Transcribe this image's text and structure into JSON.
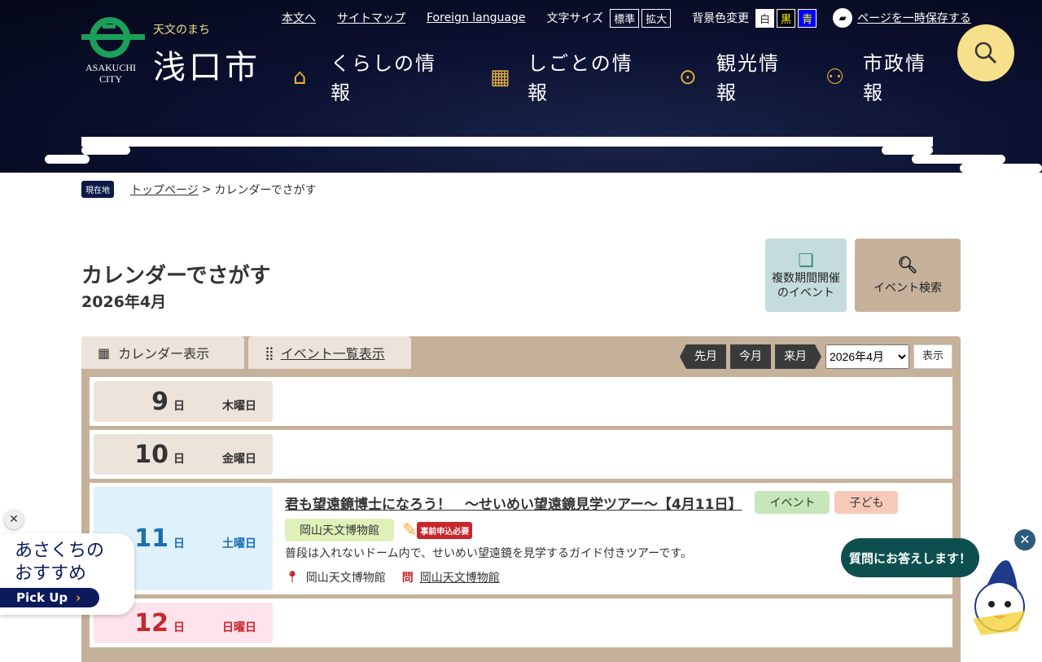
{
  "header": {
    "logo_en": "ASAKUCHI CITY",
    "logo_tagline": "天文のまち",
    "logo_city": "浅口市",
    "links": [
      "本文へ",
      "サイトマップ",
      "Foreign language"
    ],
    "font_size_label": "文字サイズ",
    "font_sizes": [
      "標準",
      "拡大"
    ],
    "bg_label": "背景色変更",
    "bg_options": [
      "白",
      "黒",
      "青"
    ],
    "save_page": "ページを一時保存する",
    "nav": [
      "くらしの情報",
      "しごとの情報",
      "観光情報",
      "市政情報"
    ]
  },
  "breadcrumb": {
    "here": "現在地",
    "home": "トップページ",
    "current": "カレンダーでさがす"
  },
  "page": {
    "title": "カレンダーでさがす",
    "month": "2026年4月",
    "multi_period": "複数期間開催のイベント",
    "event_search": "イベント検索"
  },
  "tabs": {
    "calendar": "カレンダー表示",
    "list": "イベント一覧表示"
  },
  "controls": {
    "prev": "先月",
    "current": "今月",
    "next": "来月",
    "selected_month": "2026年4月",
    "show": "表示"
  },
  "days": [
    {
      "num": "9",
      "unit": "日",
      "weekday": "木曜日"
    },
    {
      "num": "10",
      "unit": "日",
      "weekday": "金曜日"
    },
    {
      "num": "11",
      "unit": "日",
      "weekday": "土曜日"
    },
    {
      "num": "12",
      "unit": "日",
      "weekday": "日曜日"
    }
  ],
  "event": {
    "title": "君も望遠鏡博士になろう！　～せいめい望遠鏡見学ツアー～【4月11日】",
    "tags": [
      "イベント",
      "子ども"
    ],
    "venue_tag": "岡山天文博物館",
    "reservation": "事前申込必要",
    "description": "普段は入れないドーム内で、せいめい望遠鏡を見学するガイド付きツアーです。",
    "location": "岡山天文博物館",
    "contact": "岡山天文博物館"
  },
  "pickup": {
    "line1": "あさくちの",
    "line2": "おすすめ",
    "button": "Pick Up"
  },
  "chatbot": {
    "bubble": "質問にお答えします！"
  }
}
